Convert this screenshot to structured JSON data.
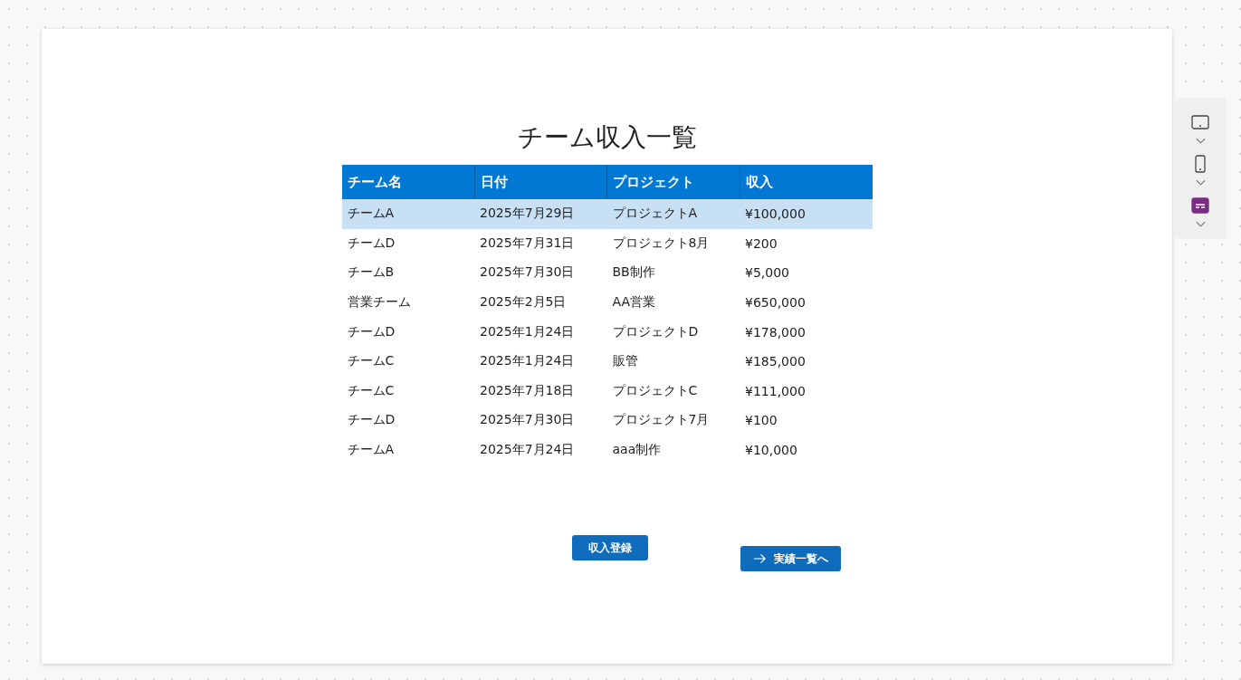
{
  "title": "チーム収入一覧",
  "table": {
    "columns": [
      "チーム名",
      "日付",
      "プロジェクト",
      "収入"
    ],
    "rows": [
      {
        "cells": [
          "チームA",
          "2025年7月29日",
          "プロジェクトA",
          "¥100,000"
        ],
        "selected": true
      },
      {
        "cells": [
          "チームD",
          "2025年7月31日",
          "プロジェクト8月",
          "¥200"
        ],
        "selected": false
      },
      {
        "cells": [
          "チームB",
          "2025年7月30日",
          "BB制作",
          "¥5,000"
        ],
        "selected": false
      },
      {
        "cells": [
          "営業チーム",
          "2025年2月5日",
          "AA営業",
          "¥650,000"
        ],
        "selected": false
      },
      {
        "cells": [
          "チームD",
          "2025年1月24日",
          "プロジェクトD",
          "¥178,000"
        ],
        "selected": false
      },
      {
        "cells": [
          "チームC",
          "2025年1月24日",
          "販管",
          "¥185,000"
        ],
        "selected": false
      },
      {
        "cells": [
          "チームC",
          "2025年7月18日",
          "プロジェクトC",
          "¥111,000"
        ],
        "selected": false
      },
      {
        "cells": [
          "チームD",
          "2025年7月30日",
          "プロジェクト7月",
          "¥100"
        ],
        "selected": false
      },
      {
        "cells": [
          "チームA",
          "2025年7月24日",
          "aaa制作",
          "¥10,000"
        ],
        "selected": false
      }
    ]
  },
  "buttons": [
    {
      "label": "収入登録",
      "kind": "plain"
    },
    {
      "label": "実績一覧へ",
      "kind": "arrow"
    }
  ],
  "side_tools": [
    {
      "kind": "tablet",
      "selected": false
    },
    {
      "kind": "phone",
      "selected": false
    },
    {
      "kind": "web",
      "selected": true
    }
  ]
}
